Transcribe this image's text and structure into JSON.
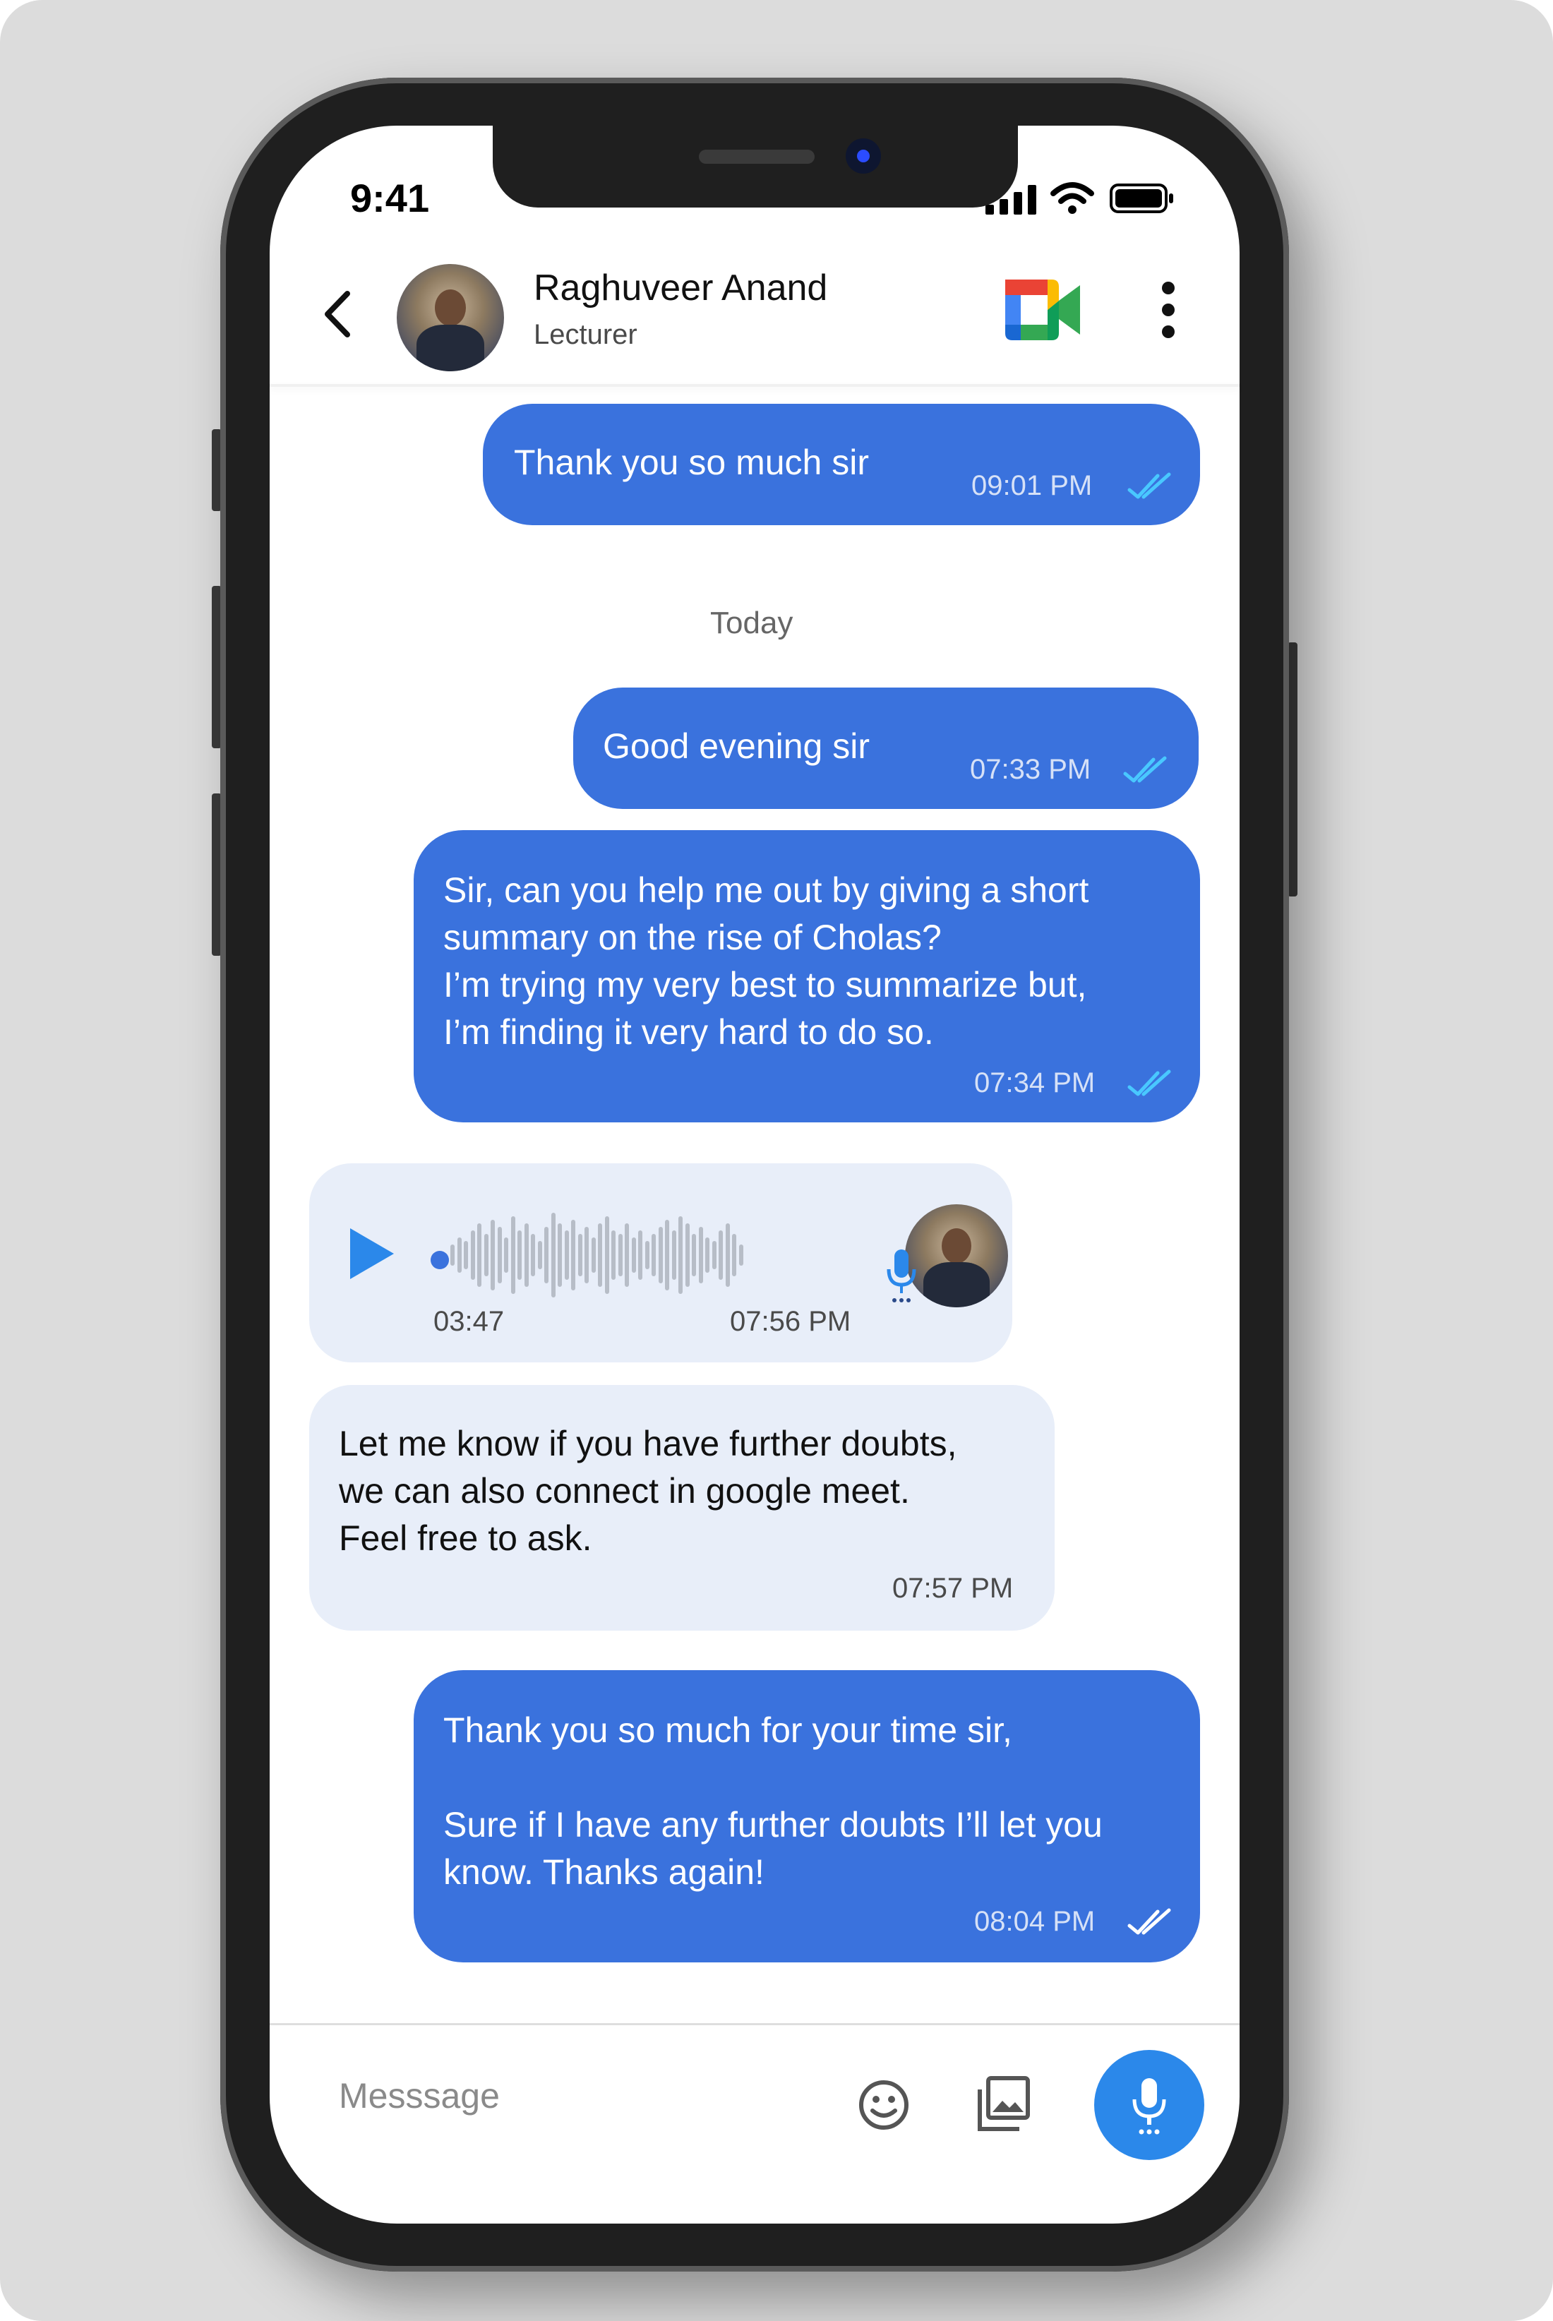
{
  "status_bar": {
    "time": "9:41"
  },
  "header": {
    "contact_name": "Raghuveer Anand",
    "contact_role": "Lecturer",
    "video_call_icon": "google-meet-icon",
    "menu_icon": "more-vertical-icon",
    "back_icon": "chevron-left-icon"
  },
  "messages": [
    {
      "direction": "out",
      "text": "Thank you so much sir",
      "time": "09:01 PM",
      "read_color": "#49c8ff"
    },
    {
      "direction": "out",
      "text": "Good evening sir",
      "time": "07:33 PM",
      "read_color": "#49c8ff"
    },
    {
      "direction": "out",
      "text": "Sir, can you help me out by giving a short\nsummary on the rise of Cholas?\nI’m trying my very best to summarize but,\nI’m finding it very hard to do so.",
      "time": "07:34 PM",
      "read_color": "#49c8ff"
    },
    {
      "direction": "in",
      "type": "voice",
      "duration": "03:47",
      "time": "07:56 PM"
    },
    {
      "direction": "in",
      "text": "Let me know if you have further doubts,\nwe can also connect in google meet.\nFeel free to ask.",
      "time": "07:57 PM"
    },
    {
      "direction": "out",
      "text": "Thank you so much for your time sir,\n\nSure if I have any further doubts I’ll let you\nknow. Thanks again!",
      "time": "08:04 PM",
      "read_color": "#ffffff"
    }
  ],
  "date_divider": "Today",
  "composer": {
    "placeholder": "Messsage",
    "emoji_icon": "emoji-icon",
    "gallery_icon": "gallery-icon",
    "mic_icon": "microphone-icon"
  },
  "colors": {
    "outgoing_bubble": "#3a72dd",
    "incoming_bubble": "#e8eef9",
    "mic_button": "#2b88ea",
    "play_button": "#2b88ea"
  }
}
